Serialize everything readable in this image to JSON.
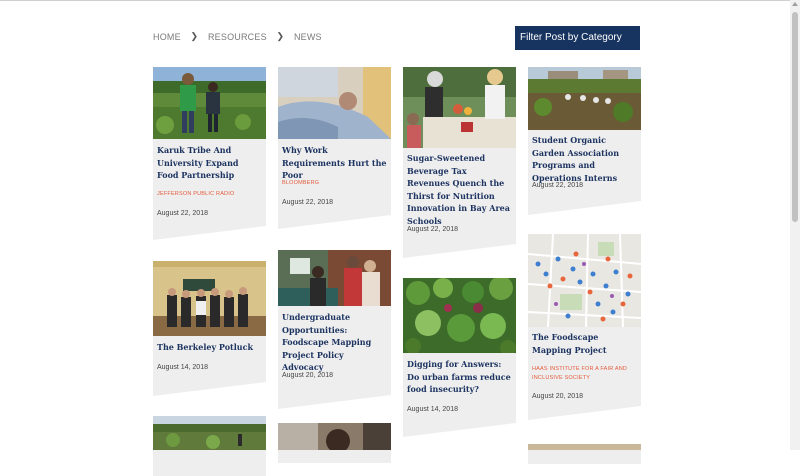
{
  "breadcrumb": {
    "home": "HOME",
    "resources": "RESOURCES",
    "news": "NEWS"
  },
  "filter": {
    "label": "Filter Post by Category"
  },
  "posts": [
    {
      "title": "Karuk Tribe And University Expand Food Partnership",
      "source": "JEFFERSON PUBLIC RADIO",
      "date": "August 22, 2018"
    },
    {
      "title": "Why Work Requirements Hurt the Poor",
      "source": "BLOOMBERG",
      "date": "August 22, 2018"
    },
    {
      "title": "Sugar-Sweetened Beverage Tax Revenues Quench the Thirst for Nutrition Innovation in Bay Area Schools",
      "source": "",
      "date": "August 22, 2018"
    },
    {
      "title": "Student Organic Garden Association Programs and Operations Interns",
      "source": "",
      "date": "August 22, 2018"
    },
    {
      "title": "The Berkeley Potluck",
      "source": "",
      "date": "August 14, 2018"
    },
    {
      "title": "Undergraduate Opportunities: Foodscape Mapping Project Policy Advocacy",
      "source": "",
      "date": "August 20, 2018"
    },
    {
      "title": "Digging for Answers: Do urban farms reduce food insecurity?",
      "source": "",
      "date": "August 14, 2018"
    },
    {
      "title": "The Foodscape Mapping Project",
      "source": "HAAS INSTITUTE FOR A FAIR AND INCLUSIVE SOCIETY",
      "date": "August 20, 2018"
    }
  ],
  "colors": {
    "navy": "#17335f",
    "title": "#1d3461",
    "source": "#e35b3b",
    "card": "#eeeeee"
  }
}
